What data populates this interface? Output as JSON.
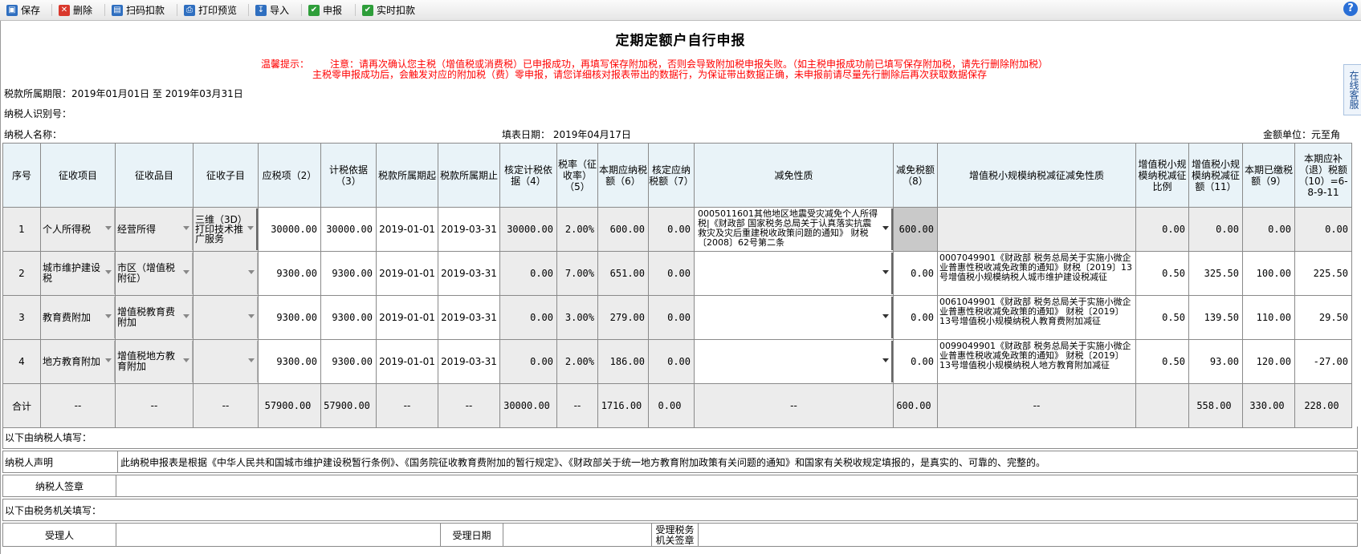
{
  "toolbar": {
    "buttons": [
      {
        "label": "保存",
        "icon": "save-icon",
        "color": "#2f6fc0"
      },
      {
        "label": "删除",
        "icon": "delete-icon",
        "color": "#d9382c"
      },
      {
        "label": "扫码扣款",
        "icon": "scan-icon",
        "color": "#2f6fc0"
      },
      {
        "label": "打印预览",
        "icon": "print-icon",
        "color": "#2f6fc0"
      },
      {
        "label": "导入",
        "icon": "import-icon",
        "color": "#2f6fc0"
      },
      {
        "label": "申报",
        "icon": "check-icon",
        "color": "#2e9e3a"
      },
      {
        "label": "实时扣款",
        "icon": "check-icon",
        "color": "#2e9e3a"
      }
    ],
    "help_glyph": "?"
  },
  "side_tab": "在线客服",
  "title": "定期定额户自行申报",
  "notice": {
    "prefix": "温馨提示：",
    "line1": "注意：请再次确认您主税（增值税或消费税）已申报成功，再填写保存附加税，否则会导致附加税申报失败。（如主税申报成功前已填写保存附加税，请先行删除附加税）",
    "line2": "主税零申报成功后，会触发对应的附加税（费）零申报，请您详细核对报表带出的数据行，为保证带出数据正确，未申报前请尽量先行删除后再次获取数据保存"
  },
  "info": {
    "period": "税款所属期限：2019年01月01日 至 2019年03月31日",
    "taxpayer_id_label": "纳税人识别号：",
    "taxpayer_name_label": "纳税人名称：",
    "fill_date": "填表日期：  2019年04月17日",
    "unit": "金额单位：元至角分"
  },
  "table": {
    "headers": [
      "序号",
      "征收项目",
      "征收品目",
      "征收子目",
      "应税项（2）",
      "计税依据（3）",
      "税款所属期起",
      "税款所属期止",
      "核定计税依据（4）",
      "税率（征收率）（5）",
      "本期应纳税额（6）",
      "核定应纳税额（7）",
      "减免性质",
      "减免税额（8）",
      "增值税小规模纳税减征减免性质",
      "增值税小规模纳税减征比例",
      "增值税小规模纳税减征额（11）",
      "本期已缴税额（9）",
      "本期应补（退）税额（10）=6-8-9-11"
    ],
    "rows": [
      {
        "no": "1",
        "item": "个人所得税",
        "category": "经营所得",
        "sub": "三维（3D）打印技术推广服务",
        "taxable": "30000.00",
        "basis": "30000.00",
        "start": "2019-01-01",
        "end": "2019-03-31",
        "approved_basis": "30000.00",
        "rate": "2.00%",
        "payable": "600.00",
        "approved_payable": "0.00",
        "relief_nature": "0005011601其他地区地震受灾减免个人所得税|《财政部 国家税务总局关于认真落实抗震救灾及灾后重建税收政策问题的通知》 财税〔2008〕62号第二条",
        "relief_amount": "600.00",
        "small_nature": "",
        "small_ratio": "0.00",
        "small_amount": "0.00",
        "paid": "0.00",
        "due": "0.00"
      },
      {
        "no": "2",
        "item": "城市维护建设税",
        "category": "市区（增值税附征）",
        "sub": "",
        "taxable": "9300.00",
        "basis": "9300.00",
        "start": "2019-01-01",
        "end": "2019-03-31",
        "approved_basis": "0.00",
        "rate": "7.00%",
        "payable": "651.00",
        "approved_payable": "0.00",
        "relief_nature": "",
        "relief_amount": "0.00",
        "small_nature": "0007049901《财政部 税务总局关于实施小微企业普惠性税收减免政策的通知》财税〔2019〕13号增值税小规模纳税人城市维护建设税减征",
        "small_ratio": "0.50",
        "small_amount": "325.50",
        "paid": "100.00",
        "due": "225.50"
      },
      {
        "no": "3",
        "item": "教育费附加",
        "category": "增值税教育费附加",
        "sub": "",
        "taxable": "9300.00",
        "basis": "9300.00",
        "start": "2019-01-01",
        "end": "2019-03-31",
        "approved_basis": "0.00",
        "rate": "3.00%",
        "payable": "279.00",
        "approved_payable": "0.00",
        "relief_nature": "",
        "relief_amount": "0.00",
        "small_nature": "0061049901《财政部 税务总局关于实施小微企业普惠性税收减免政策的通知》 财税〔2019〕13号增值税小规模纳税人教育费附加减征",
        "small_ratio": "0.50",
        "small_amount": "139.50",
        "paid": "110.00",
        "due": "29.50"
      },
      {
        "no": "4",
        "item": "地方教育附加",
        "category": "增值税地方教育附加",
        "sub": "",
        "taxable": "9300.00",
        "basis": "9300.00",
        "start": "2019-01-01",
        "end": "2019-03-31",
        "approved_basis": "0.00",
        "rate": "2.00%",
        "payable": "186.00",
        "approved_payable": "0.00",
        "relief_nature": "",
        "relief_amount": "0.00",
        "small_nature": "0099049901《财政部 税务总局关于实施小微企业普惠性税收减免政策的通知》 财税〔2019〕13号增值税小规模纳税人地方教育附加减征",
        "small_ratio": "0.50",
        "small_amount": "93.00",
        "paid": "120.00",
        "due": "-27.00"
      }
    ],
    "total": {
      "label": "合计",
      "dash": "--",
      "taxable": "57900.00",
      "basis": "57900.00",
      "approved_basis": "30000.00",
      "payable": "1716.00",
      "approved_payable": "0.00",
      "relief_amount": "600.00",
      "small_amount": "558.00",
      "paid": "330.00",
      "due": "228.00"
    }
  },
  "footer": {
    "taxpayer_fill": "以下由纳税人填写：",
    "declaration_label": "纳税人声明",
    "declaration_text": "此纳税申报表是根据《中华人民共和国城市维护建设税暂行条例》、《国务院征收教育费附加的暂行规定》、《财政部关于统一地方教育附加政策有关问题的通知》和国家有关税收规定填报的，是真实的、可靠的、完整的。",
    "signature_label": "纳税人签章",
    "authority_fill": "以下由税务机关填写：",
    "receiver_label": "受理人",
    "receive_date_label": "受理日期",
    "authority_seal_label": "受理税务机关签章"
  }
}
